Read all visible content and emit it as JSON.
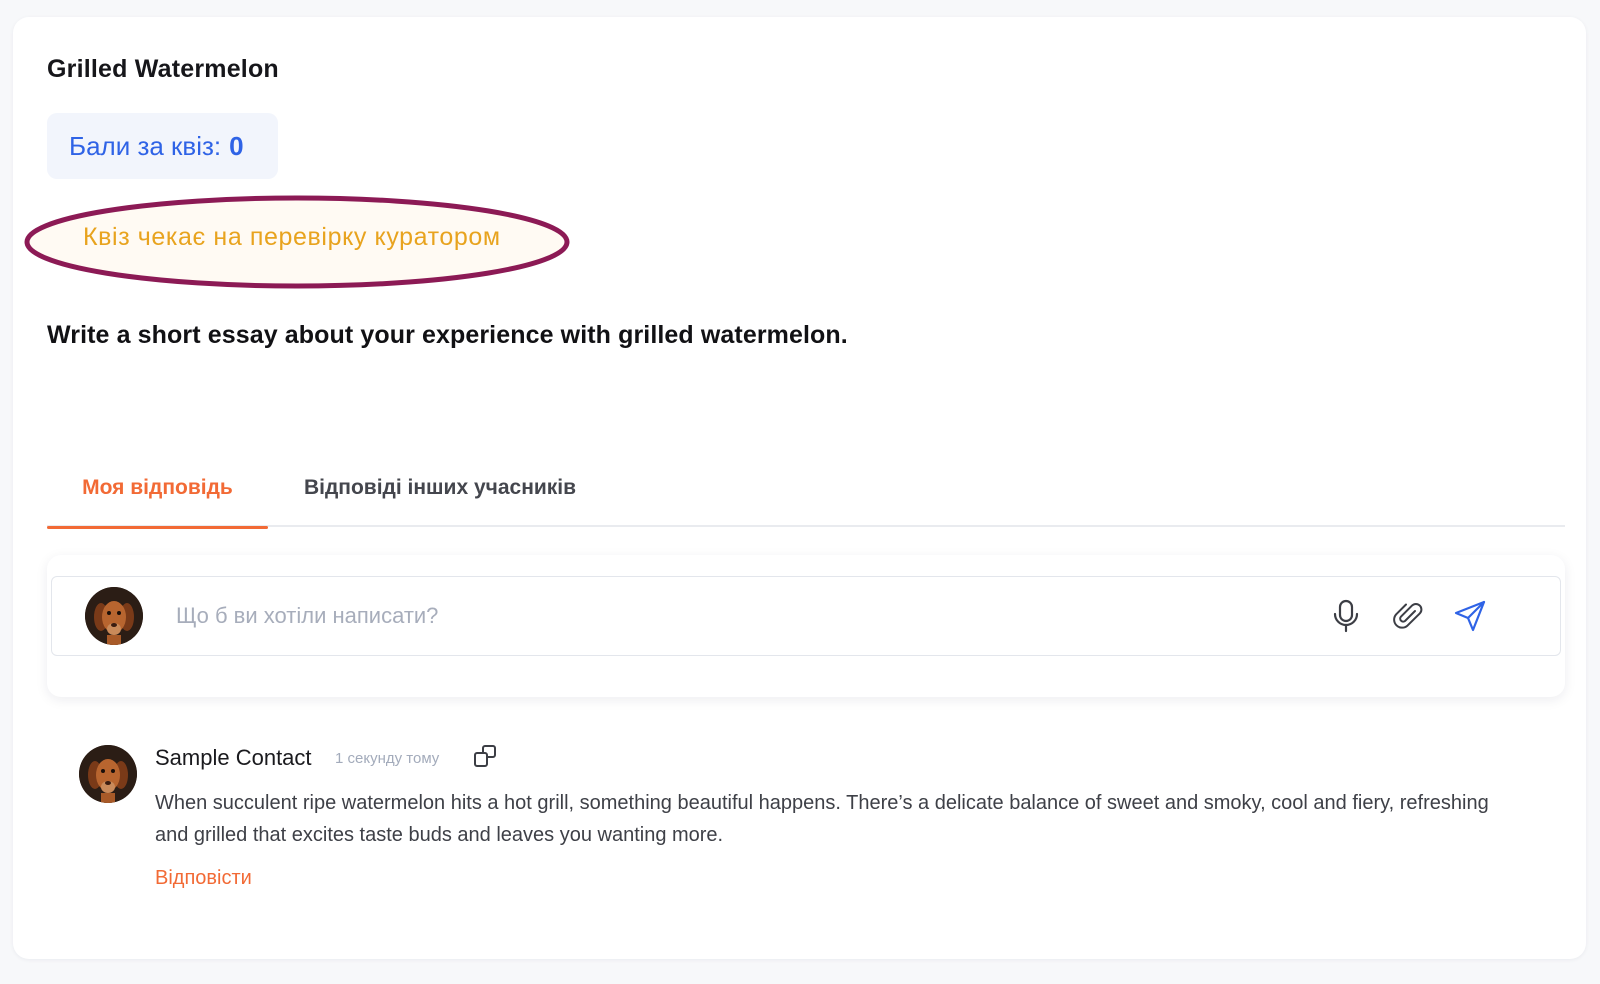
{
  "quiz": {
    "title": "Grilled Watermelon",
    "score_label": "Бали за квіз:",
    "score_value": "0",
    "status": "Квіз чекає на перевірку куратором",
    "question": "Write a short essay about your experience with grilled watermelon."
  },
  "tabs": [
    {
      "label": "Моя відповідь",
      "active": true
    },
    {
      "label": "Відповіді інших учасників",
      "active": false
    }
  ],
  "composer": {
    "placeholder": "Що б ви хотіли написати?",
    "icons": [
      "microphone-icon",
      "paperclip-icon",
      "send-icon"
    ]
  },
  "comments": [
    {
      "author": "Sample Contact",
      "time": "1 секунду тому",
      "text": "When succulent ripe watermelon hits a hot grill, something beautiful happens. There’s a delicate balance of sweet and smoky, cool and fiery, refreshing and grilled that excites taste buds and leaves you wanting more.",
      "reply_label": "Відповісти"
    }
  ],
  "colors": {
    "accent_orange": "#f26a35",
    "score_blue": "#2f63e6",
    "status_yellow": "#e8a31e",
    "highlight_ellipse": "#8c1a55"
  }
}
